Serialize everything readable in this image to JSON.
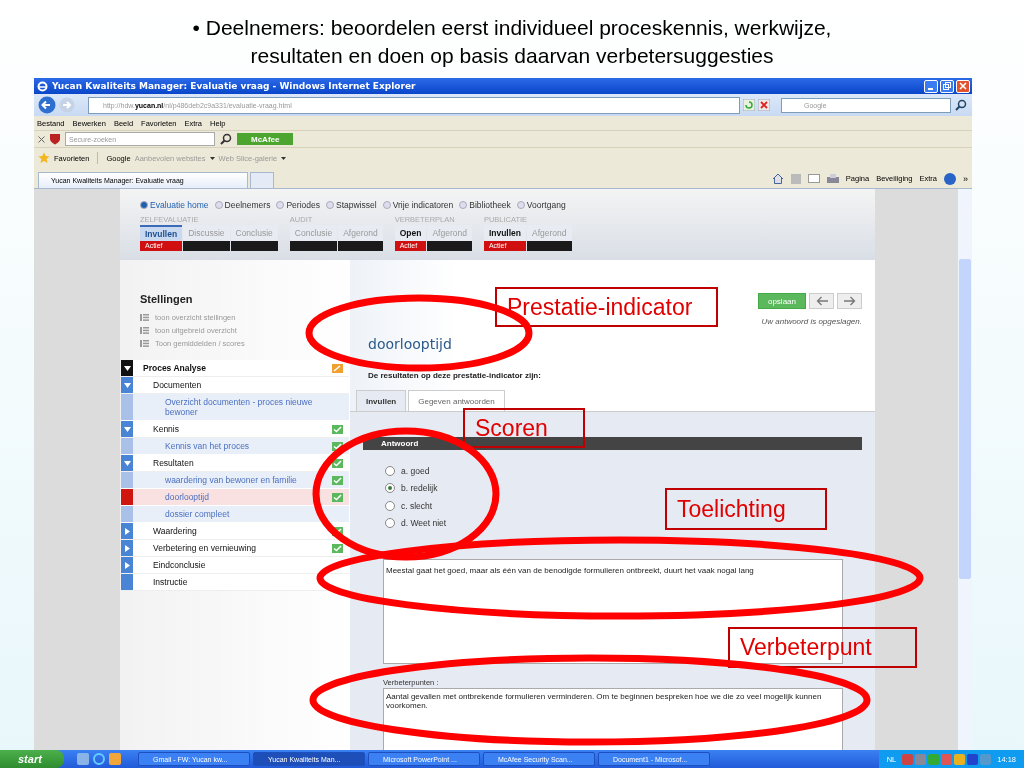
{
  "slide_title": [
    "• Deelnemers: beoordelen eerst individueel  proceskennis, werkwijze,",
    "resultaten en doen op basis daarvan verbetersuggesties"
  ],
  "window": {
    "title": "Yucan Kwaliteits Manager: Evaluatie vraag - Windows Internet Explorer"
  },
  "address_bar": {
    "url": "http://hdw.**yucan.nl**/nl/p486deb2c9a331/evaluatie-vraag.html"
  },
  "search_box": {
    "placeholder": "Google"
  },
  "menu": [
    "Bestand",
    "Bewerken",
    "Beeld",
    "Favorieten",
    "Extra",
    "Help"
  ],
  "security_toolbar": {
    "search_placeholder": "Secure-zoeken",
    "button": "McAfee"
  },
  "favorites_bar": {
    "label": "Favorieten",
    "items": [
      {
        "label": "Google",
        "kind": "link"
      },
      {
        "label": "Aanbevolen websites",
        "kind": "menu"
      },
      {
        "label": "Web Slice-galerie",
        "kind": "menu"
      }
    ]
  },
  "browser_tab": {
    "title": "Yucan Kwaliteits Manager: Evaluatie vraag"
  },
  "command_bar": {
    "menus": [
      "Pagina",
      "Beveiliging",
      "Extra"
    ],
    "overflow": "»"
  },
  "nav": [
    {
      "label": "Evaluatie home",
      "selected": true
    },
    {
      "label": "Deelnemers",
      "selected": false
    },
    {
      "label": "Periodes",
      "selected": false
    },
    {
      "label": "Stapwissel",
      "selected": false
    },
    {
      "label": "Vrije indicatoren",
      "selected": false
    },
    {
      "label": "Bibliotheek",
      "selected": false
    },
    {
      "label": "Voortgang",
      "selected": false
    }
  ],
  "phases": [
    {
      "title": "ZELFEVALUATIE",
      "steps": [
        {
          "label": "Invullen",
          "selected": true,
          "active": true,
          "status": "Actief"
        },
        {
          "label": "Discussie",
          "selected": false,
          "active": false
        },
        {
          "label": "Conclusie",
          "selected": false,
          "active": false
        }
      ]
    },
    {
      "title": "AUDIT",
      "steps": [
        {
          "label": "Conclusie",
          "selected": false,
          "active": false
        },
        {
          "label": "Afgerond",
          "selected": false,
          "active": false
        }
      ]
    },
    {
      "title": "VERBETERPLAN",
      "steps": [
        {
          "label": "Open",
          "selected": false,
          "active": true,
          "status": "Actief"
        },
        {
          "label": "Afgerond",
          "selected": false,
          "active": false
        }
      ]
    },
    {
      "title": "PUBLICATIE",
      "steps": [
        {
          "label": "Invullen",
          "selected": false,
          "active": true,
          "status": "Actief"
        },
        {
          "label": "Afgerond",
          "selected": false,
          "active": false
        }
      ]
    }
  ],
  "sidebar": {
    "title": "Stellingen",
    "links": [
      "toon overzicht stellingen",
      "toon uitgebreid overzicht",
      "Toon gemiddelden / scores"
    ],
    "tree": [
      {
        "label": "Proces Analyse",
        "expanded": true,
        "selected": false,
        "done": false,
        "children": [
          {
            "label": "Documenten",
            "expanded": true,
            "selected": false,
            "children": [
              {
                "label": "Overzicht documenten - proces nieuwe bewoner",
                "selected": false
              }
            ]
          },
          {
            "label": "Kennis",
            "expanded": true,
            "selected": false,
            "done": true,
            "children": [
              {
                "label": "Kennis van het proces",
                "selected": false,
                "done": true
              }
            ]
          },
          {
            "label": "Resultaten",
            "expanded": true,
            "selected": false,
            "done": true,
            "children": [
              {
                "label": "waardering van bewoner en familie",
                "selected": false,
                "done": true
              },
              {
                "label": "doorlooptijd",
                "selected": true,
                "done": true
              },
              {
                "label": "dossier compleet",
                "selected": false
              }
            ]
          },
          {
            "label": "Waardering",
            "expanded": false,
            "selected": false,
            "done": true
          },
          {
            "label": "Verbetering en vernieuwing",
            "expanded": false,
            "selected": false,
            "done": true
          },
          {
            "label": "Eindconclusie",
            "expanded": false,
            "selected": false
          },
          {
            "label": "Instructie",
            "selected": false
          }
        ]
      }
    ]
  },
  "question": {
    "save_button": "opslaan",
    "save_message": "Uw antwoord is opgeslagen.",
    "title": "doorlooptijd",
    "intro": "De resultaten op deze prestatie-indicator zijn:",
    "tabs": [
      {
        "label": "Invullen",
        "selected": true
      },
      {
        "label": "Gegeven antwoorden",
        "selected": false
      }
    ],
    "answer_header": "Antwoord",
    "options": [
      {
        "label": "a. goed",
        "selected": false
      },
      {
        "label": "b. redelijk",
        "selected": true
      },
      {
        "label": "c. slecht",
        "selected": false
      },
      {
        "label": "d. Weet niet",
        "selected": false
      }
    ],
    "explanation": "Meestal gaat het goed, maar als één van de benodigde formulieren ontbreekt, duurt het vaak nogal lang",
    "improvements_label": "Verbeterpunten :",
    "improvements": "Aantal gevallen met ontbrekende formulieren verminderen. Om te beginnen bespreken hoe we die zo veel mogelijk kunnen voorkomen."
  },
  "annotations": [
    "Prestatie-indicator",
    "Scoren",
    "Toelichting",
    "Verbeterpunt"
  ],
  "taskbar": {
    "start": "start",
    "tasks": [
      {
        "label": "Gmail - FW: Yucan kw...",
        "selected": false
      },
      {
        "label": "Yucan Kwaliteits Man...",
        "selected": true
      },
      {
        "label": "Microsoft PowerPoint ...",
        "selected": false
      },
      {
        "label": "McAfee Security Scan...",
        "selected": false
      },
      {
        "label": "Document1 - Microsof...",
        "selected": false
      }
    ],
    "language": "NL",
    "clock": "14:18"
  }
}
